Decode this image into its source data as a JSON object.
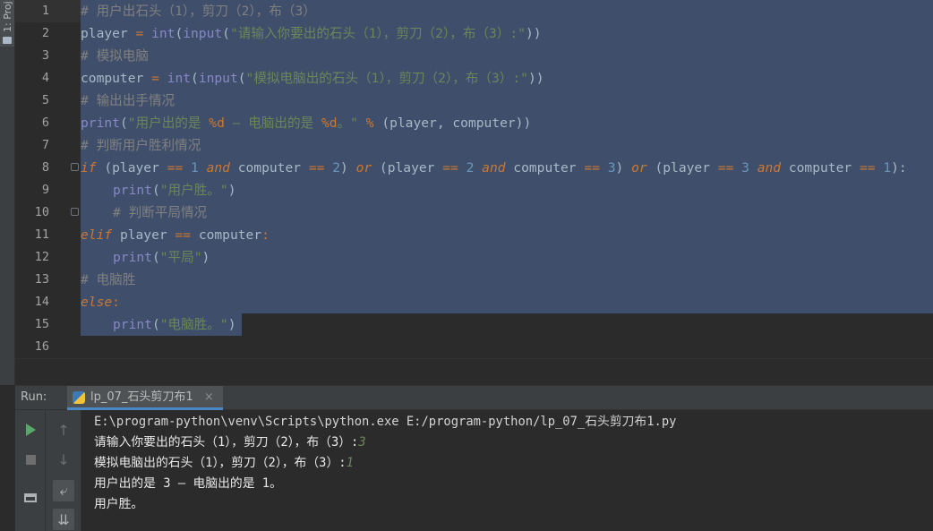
{
  "sidebar": {
    "project_tab_label": "1: Proj"
  },
  "editor": {
    "line_numbers": [
      "1",
      "2",
      "3",
      "4",
      "5",
      "6",
      "7",
      "8",
      "9",
      "10",
      "11",
      "12",
      "13",
      "14",
      "15",
      "16"
    ],
    "lines": {
      "l1": "# 用户出石头（1），剪刀（2），布（3）",
      "l2_a": "player",
      "l2_b": " = ",
      "l2_c": "int",
      "l2_d": "(",
      "l2_e": "input",
      "l2_f": "(",
      "l2_g": "\"请输入你要出的石头（1），剪刀（2），布（3）:\"",
      "l2_h": "))",
      "l3": "# 模拟电脑",
      "l4_a": "computer",
      "l4_b": " = ",
      "l4_c": "int",
      "l4_d": "(",
      "l4_e": "input",
      "l4_f": "(",
      "l4_g": "\"模拟电脑出的石头（1），剪刀（2），布（3）:\"",
      "l4_h": "))",
      "l5": "# 输出出手情况",
      "l6_a": "print",
      "l6_b": "(",
      "l6_c": "\"用户出的是 ",
      "l6_d": "%d",
      "l6_e": " — 电脑出的是 ",
      "l6_f": "%d",
      "l6_g": "。\"",
      "l6_h": " % ",
      "l6_i": "(player, computer))",
      "l7": "# 判断用户胜利情况",
      "l8_if": "if",
      "l8_p1": " (player ",
      "l8_eq1": "==",
      "l8_n1": " 1 ",
      "l8_and1": "and",
      "l8_c1": " computer ",
      "l8_eq2": "==",
      "l8_n2": " 2",
      "l8_p2": ") ",
      "l8_or1": "or",
      "l8_p3": " (player ",
      "l8_eq3": "==",
      "l8_n3": " 2 ",
      "l8_and2": "and",
      "l8_c2": " computer ",
      "l8_eq4": "==",
      "l8_n4": " 3",
      "l8_p4": ") ",
      "l8_or2": "or",
      "l8_p5": " (player ",
      "l8_eq5": "==",
      "l8_n5": " 3 ",
      "l8_and3": "and",
      "l8_c3": " computer ",
      "l8_eq6": "==",
      "l8_n6": " 1",
      "l8_p6": "):",
      "l9_a": "print",
      "l9_b": "(",
      "l9_c": "\"用户胜。\"",
      "l9_d": ")",
      "l10": "# 判断平局情况",
      "l11_a": "elif",
      "l11_b": " player ",
      "l11_c": "==",
      "l11_d": " computer",
      "l11_e": ":",
      "l12_a": "print",
      "l12_b": "(",
      "l12_c": "\"平局\"",
      "l12_d": ")",
      "l13": "# 电脑胜",
      "l14_a": "else",
      "l14_b": ":",
      "l15_a": "print",
      "l15_b": "(",
      "l15_c": "\"电脑胜。\"",
      "l15_d": ")"
    }
  },
  "run_panel": {
    "label": "Run:",
    "tab_name": "lp_07_石头剪刀布1",
    "tab_close": "×",
    "console": {
      "command": "E:\\program-python\\venv\\Scripts\\python.exe E:/program-python/lp_07_石头剪刀布1.py",
      "prompt1": "请输入你要出的石头（1），剪刀（2），布（3）:",
      "input1": "3",
      "prompt2": "模拟电脑出的石头（1），剪刀（2），布（3）:",
      "input2": "1",
      "output1": "用户出的是 3 — 电脑出的是 1。",
      "output2": "用户胜。"
    }
  },
  "icons": {
    "up": "↑",
    "down": "↓",
    "wrap": "⤶",
    "scroll_end": "⇊"
  }
}
